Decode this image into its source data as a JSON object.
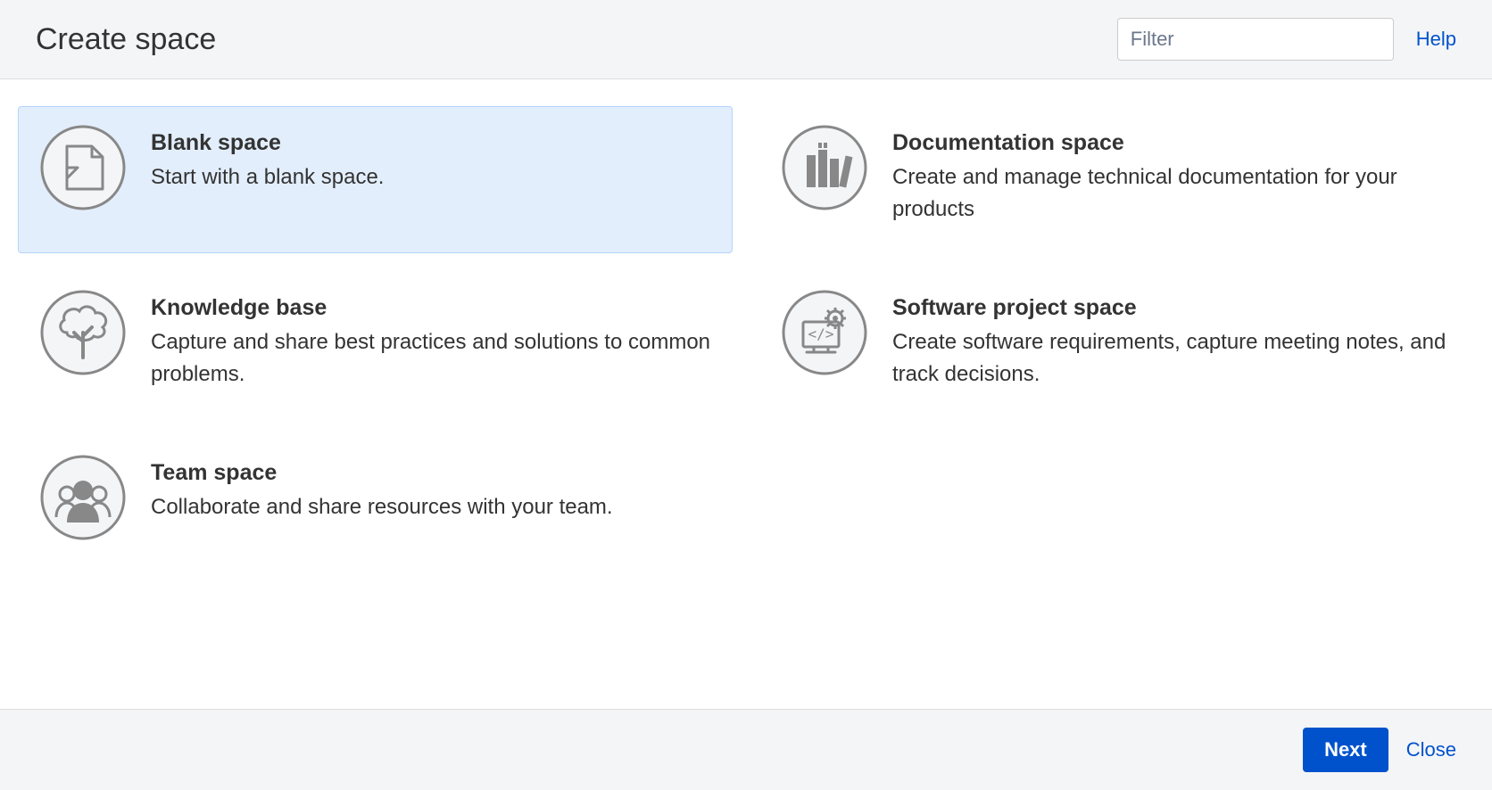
{
  "header": {
    "title": "Create space",
    "filter_placeholder": "Filter",
    "help_label": "Help"
  },
  "cards": {
    "blank": {
      "title": "Blank space",
      "description": "Start with a blank space."
    },
    "documentation": {
      "title": "Documentation space",
      "description": "Create and manage technical documentation for your products"
    },
    "knowledge": {
      "title": "Knowledge base",
      "description": "Capture and share best practices and solutions to common problems."
    },
    "software": {
      "title": "Software project space",
      "description": "Create software requirements, capture meeting notes, and track decisions."
    },
    "team": {
      "title": "Team space",
      "description": "Collaborate and share resources with your team."
    }
  },
  "footer": {
    "next_label": "Next",
    "close_label": "Close"
  }
}
